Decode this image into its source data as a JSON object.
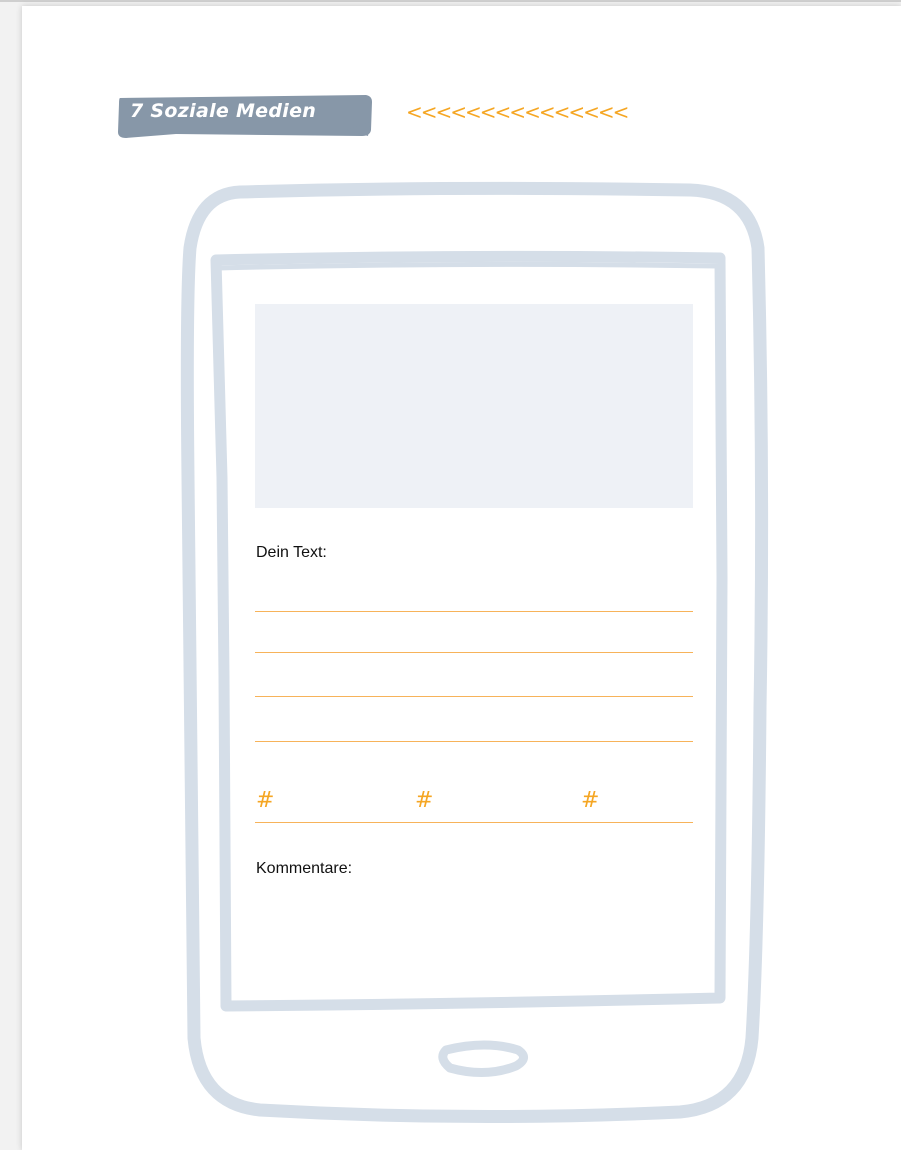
{
  "heading": {
    "number_title": "7 Soziale Medien",
    "decoration": "<<<<<<<<<<<<<<<"
  },
  "form": {
    "text_label": "Dein Text:",
    "hash_symbols": [
      "#",
      "#",
      "#"
    ],
    "comments_label": "Kommentare:"
  },
  "colors": {
    "banner": "#8797a8",
    "accent_orange": "#f5a623",
    "device_outline": "#d5dee8",
    "image_placeholder": "#eef1f6"
  },
  "icons": {
    "device": "tablet-outline-icon",
    "home_button": "home-button-icon"
  }
}
